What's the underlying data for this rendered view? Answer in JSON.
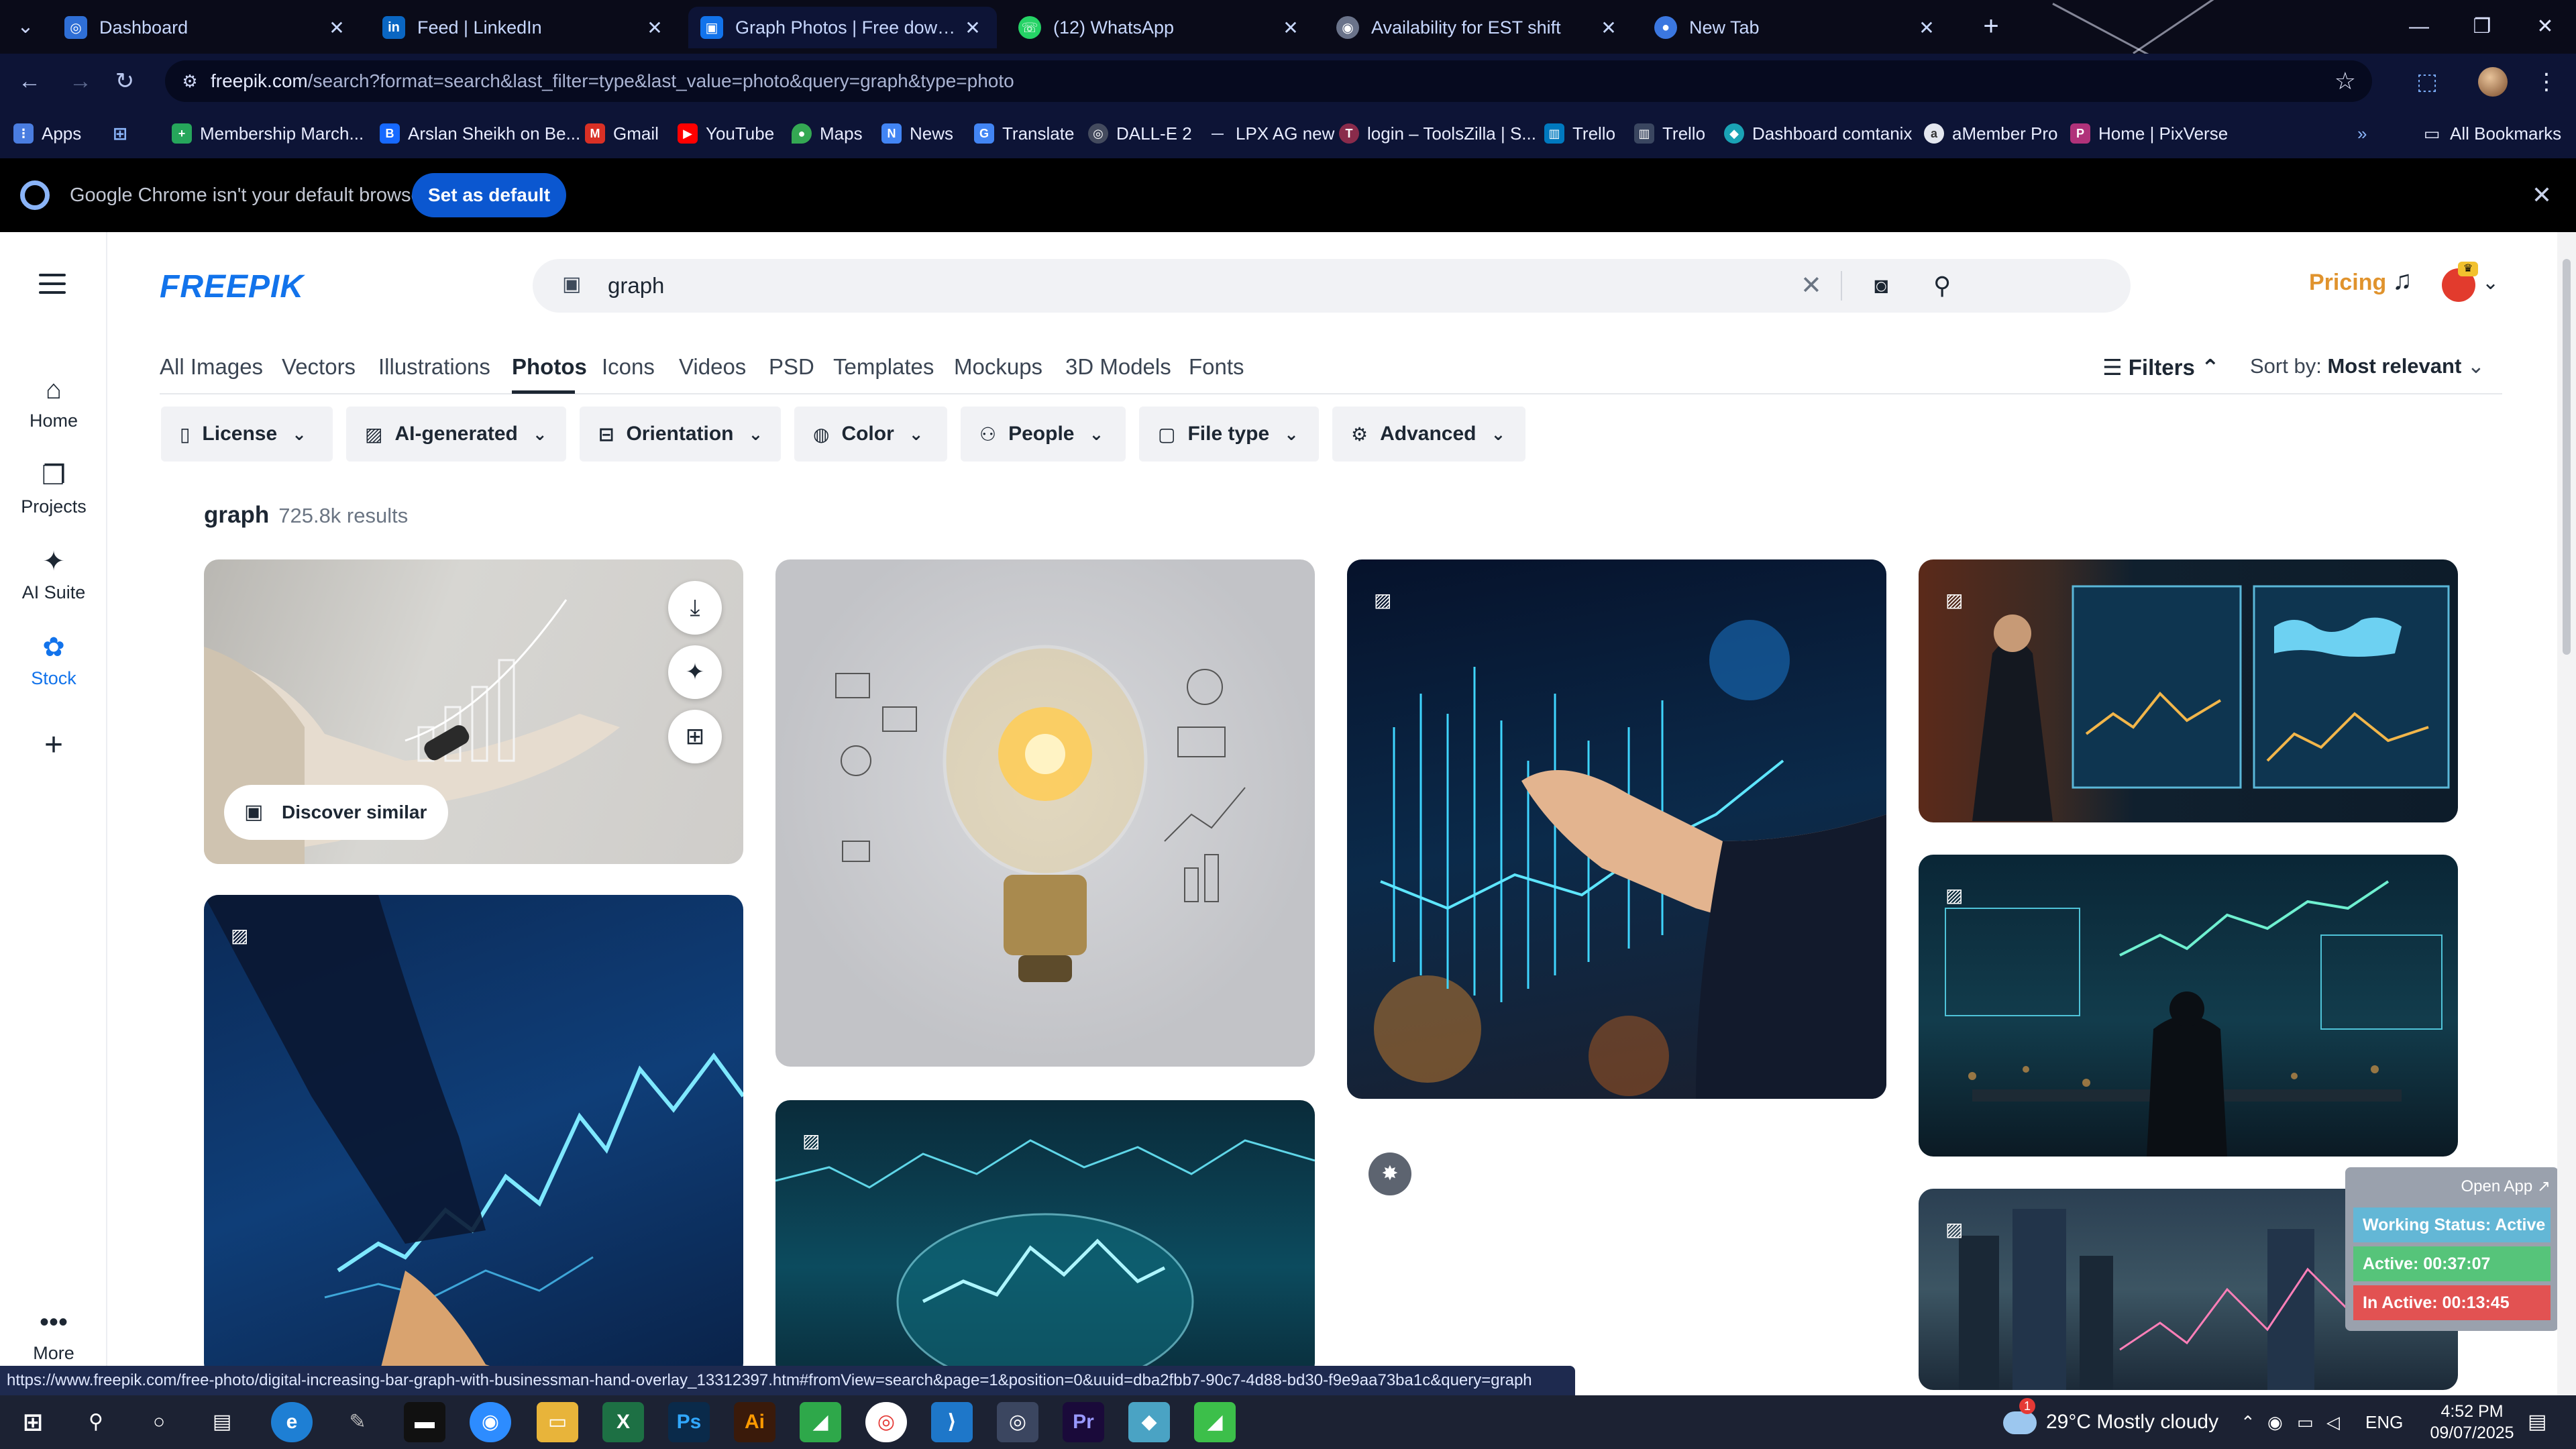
{
  "browser": {
    "tabs": [
      {
        "title": "Dashboard",
        "icon": "globe-icon"
      },
      {
        "title": "Feed | LinkedIn",
        "icon": "linkedin-icon"
      },
      {
        "title": "Graph Photos | Free download",
        "icon": "freepik-icon"
      },
      {
        "title": "(12) WhatsApp",
        "icon": "whatsapp-icon"
      },
      {
        "title": "Availability for EST shift",
        "icon": "globe-icon"
      },
      {
        "title": "New Tab",
        "icon": "chrome-icon"
      }
    ],
    "url_host": "freepik.com",
    "url_rest": "/search?format=search&last_filter=type&last_value=photo&query=graph&type=photo",
    "bookmarks": [
      {
        "label": "Apps"
      },
      {
        "label": "Membership March..."
      },
      {
        "label": "Arslan Sheikh on Be..."
      },
      {
        "label": "Gmail"
      },
      {
        "label": "YouTube"
      },
      {
        "label": "Maps"
      },
      {
        "label": "News"
      },
      {
        "label": "Translate"
      },
      {
        "label": "DALL-E 2"
      },
      {
        "label": "LPX AG new"
      },
      {
        "label": "login – ToolsZilla | S..."
      },
      {
        "label": "Trello"
      },
      {
        "label": "Trello"
      },
      {
        "label": "Dashboard comtanix"
      },
      {
        "label": "aMember Pro"
      },
      {
        "label": "Home | PixVerse"
      }
    ],
    "all_bookmarks": "All Bookmarks",
    "infobar_message": "Google Chrome isn't your default browser",
    "set_default": "Set as default"
  },
  "site": {
    "logo": "FREEPIK",
    "sidebar": [
      {
        "label": "Home",
        "icon": "home-icon"
      },
      {
        "label": "Projects",
        "icon": "projects-icon"
      },
      {
        "label": "AI Suite",
        "icon": "ai-suite-icon"
      },
      {
        "label": "Stock",
        "icon": "stock-icon"
      },
      {
        "label": "More",
        "icon": "more-icon"
      }
    ],
    "search_value": "graph",
    "pricing": "Pricing",
    "type_tabs": [
      "All Images",
      "Vectors",
      "Illustrations",
      "Photos",
      "Icons",
      "Videos",
      "PSD",
      "Templates",
      "Mockups",
      "3D Models",
      "Fonts"
    ],
    "active_tab": "Photos",
    "filters_label": "Filters",
    "sort_label": "Sort by:",
    "sort_value": "Most relevant",
    "filter_chips": [
      "License",
      "AI-generated",
      "Orientation",
      "Color",
      "People",
      "File type",
      "Advanced"
    ],
    "results_query": "graph",
    "results_count": "725.8k results",
    "discover_similar": "Discover similar"
  },
  "status_url": "https://www.freepik.com/free-photo/digital-increasing-bar-graph-with-businessman-hand-overlay_13312397.htm#fromView=search&page=1&position=0&uuid=dba2fbb7-90c7-4d88-bd30-f9e9aa73ba1c&query=graph",
  "widget": {
    "open_app": "Open App ↗",
    "working_status": "Working Status: Active",
    "active": "Active: 00:37:07",
    "inactive": "In Active: 00:13:45"
  },
  "taskbar": {
    "weather": "29°C  Mostly cloudy",
    "weather_badge": "1",
    "language": "ENG",
    "time": "4:52 PM",
    "date": "09/07/2025"
  },
  "colors": {
    "brand": "#1273eb",
    "pricing": "#e0932d",
    "chrome_dark": "#0d1436",
    "widget_status": "#63b7d6",
    "widget_active": "#56c47a",
    "widget_inactive": "#e25252"
  }
}
